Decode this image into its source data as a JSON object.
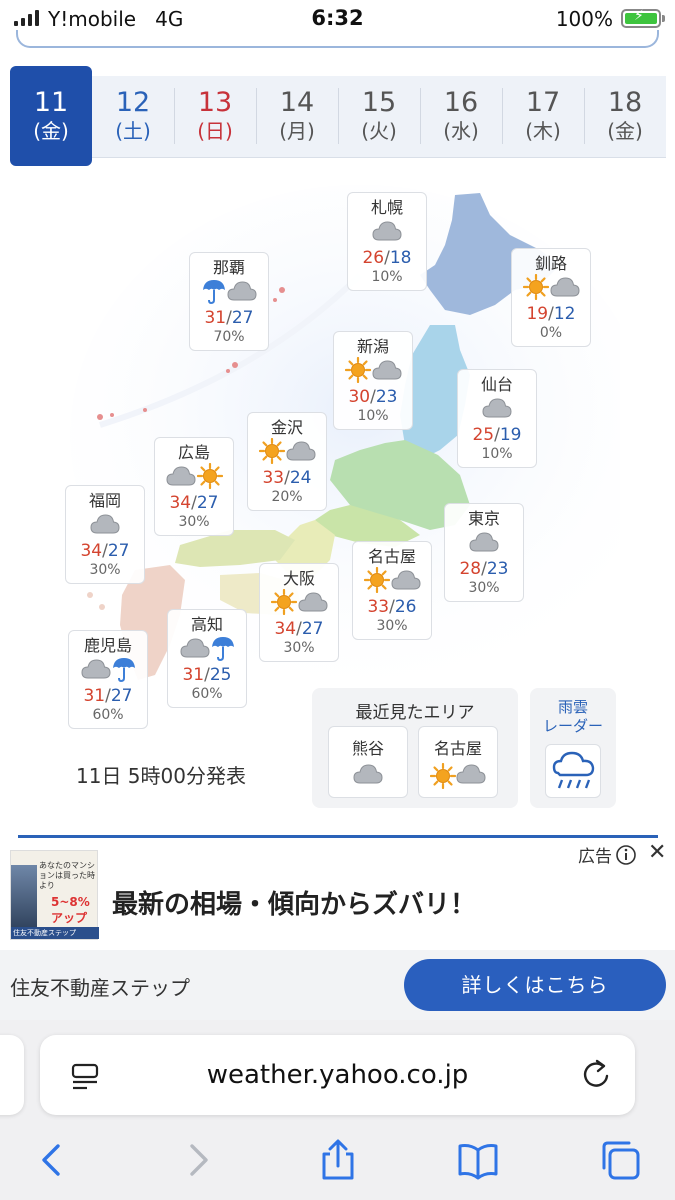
{
  "status_bar": {
    "carrier": "Y!mobile",
    "network": "4G",
    "time": "6:32",
    "battery": "100%"
  },
  "date_tabs": [
    {
      "day": "11",
      "dow": "(金)",
      "type": "active"
    },
    {
      "day": "12",
      "dow": "(土)",
      "type": "sat"
    },
    {
      "day": "13",
      "dow": "(日)",
      "type": "sun"
    },
    {
      "day": "14",
      "dow": "(月)",
      "type": "weekday"
    },
    {
      "day": "15",
      "dow": "(火)",
      "type": "weekday"
    },
    {
      "day": "16",
      "dow": "(水)",
      "type": "weekday"
    },
    {
      "day": "17",
      "dow": "(木)",
      "type": "weekday"
    },
    {
      "day": "18",
      "dow": "(金)",
      "type": "weekday"
    }
  ],
  "cities": [
    {
      "name": "札幌",
      "icons": [
        "cloud"
      ],
      "high": "26",
      "low": "18",
      "rain": "10%"
    },
    {
      "name": "釧路",
      "icons": [
        "sun",
        "cloud"
      ],
      "high": "19",
      "low": "12",
      "rain": "0%"
    },
    {
      "name": "那覇",
      "icons": [
        "umbrella",
        "cloud"
      ],
      "high": "31",
      "low": "27",
      "rain": "70%"
    },
    {
      "name": "新潟",
      "icons": [
        "sun",
        "cloud"
      ],
      "high": "30",
      "low": "23",
      "rain": "10%"
    },
    {
      "name": "仙台",
      "icons": [
        "cloud"
      ],
      "high": "25",
      "low": "19",
      "rain": "10%"
    },
    {
      "name": "金沢",
      "icons": [
        "sun",
        "cloud"
      ],
      "high": "33",
      "low": "24",
      "rain": "20%"
    },
    {
      "name": "広島",
      "icons": [
        "cloud",
        "sun"
      ],
      "high": "34",
      "low": "27",
      "rain": "30%"
    },
    {
      "name": "福岡",
      "icons": [
        "cloud"
      ],
      "high": "34",
      "low": "27",
      "rain": "30%"
    },
    {
      "name": "東京",
      "icons": [
        "cloud"
      ],
      "high": "28",
      "low": "23",
      "rain": "30%"
    },
    {
      "name": "名古屋",
      "icons": [
        "sun",
        "cloud"
      ],
      "high": "33",
      "low": "26",
      "rain": "30%"
    },
    {
      "name": "大阪",
      "icons": [
        "sun",
        "cloud"
      ],
      "high": "34",
      "low": "27",
      "rain": "30%"
    },
    {
      "name": "高知",
      "icons": [
        "cloud",
        "umbrella"
      ],
      "high": "31",
      "low": "25",
      "rain": "60%"
    },
    {
      "name": "鹿児島",
      "icons": [
        "cloud",
        "umbrella"
      ],
      "high": "31",
      "low": "27",
      "rain": "60%"
    }
  ],
  "recent_areas": {
    "title": "最近見たエリア",
    "items": [
      {
        "name": "熊谷",
        "icons": [
          "cloud"
        ]
      },
      {
        "name": "名古屋",
        "icons": [
          "sun",
          "cloud"
        ]
      }
    ]
  },
  "radar": {
    "label_line1": "雨雲",
    "label_line2": "レーダー"
  },
  "issued": "11日 5時00分発表",
  "ad": {
    "label": "広告",
    "headline": "最新の相場・傾向からズバリ！",
    "sponsor": "住友不動産ステップ",
    "cta": "詳しくはこちら",
    "image_text": "あなたのマンションは買った時より",
    "image_percent": "5~8%アップ",
    "image_footer": "住友不動産ステップ"
  },
  "browser": {
    "url": "weather.yahoo.co.jp"
  },
  "colors": {
    "accent": "#1f4faa",
    "high_temp": "#d4442f",
    "low_temp": "#2b5dad",
    "sun": "#f0a020",
    "cloud": "#a9adb3",
    "umbrella": "#3d7fd8"
  }
}
